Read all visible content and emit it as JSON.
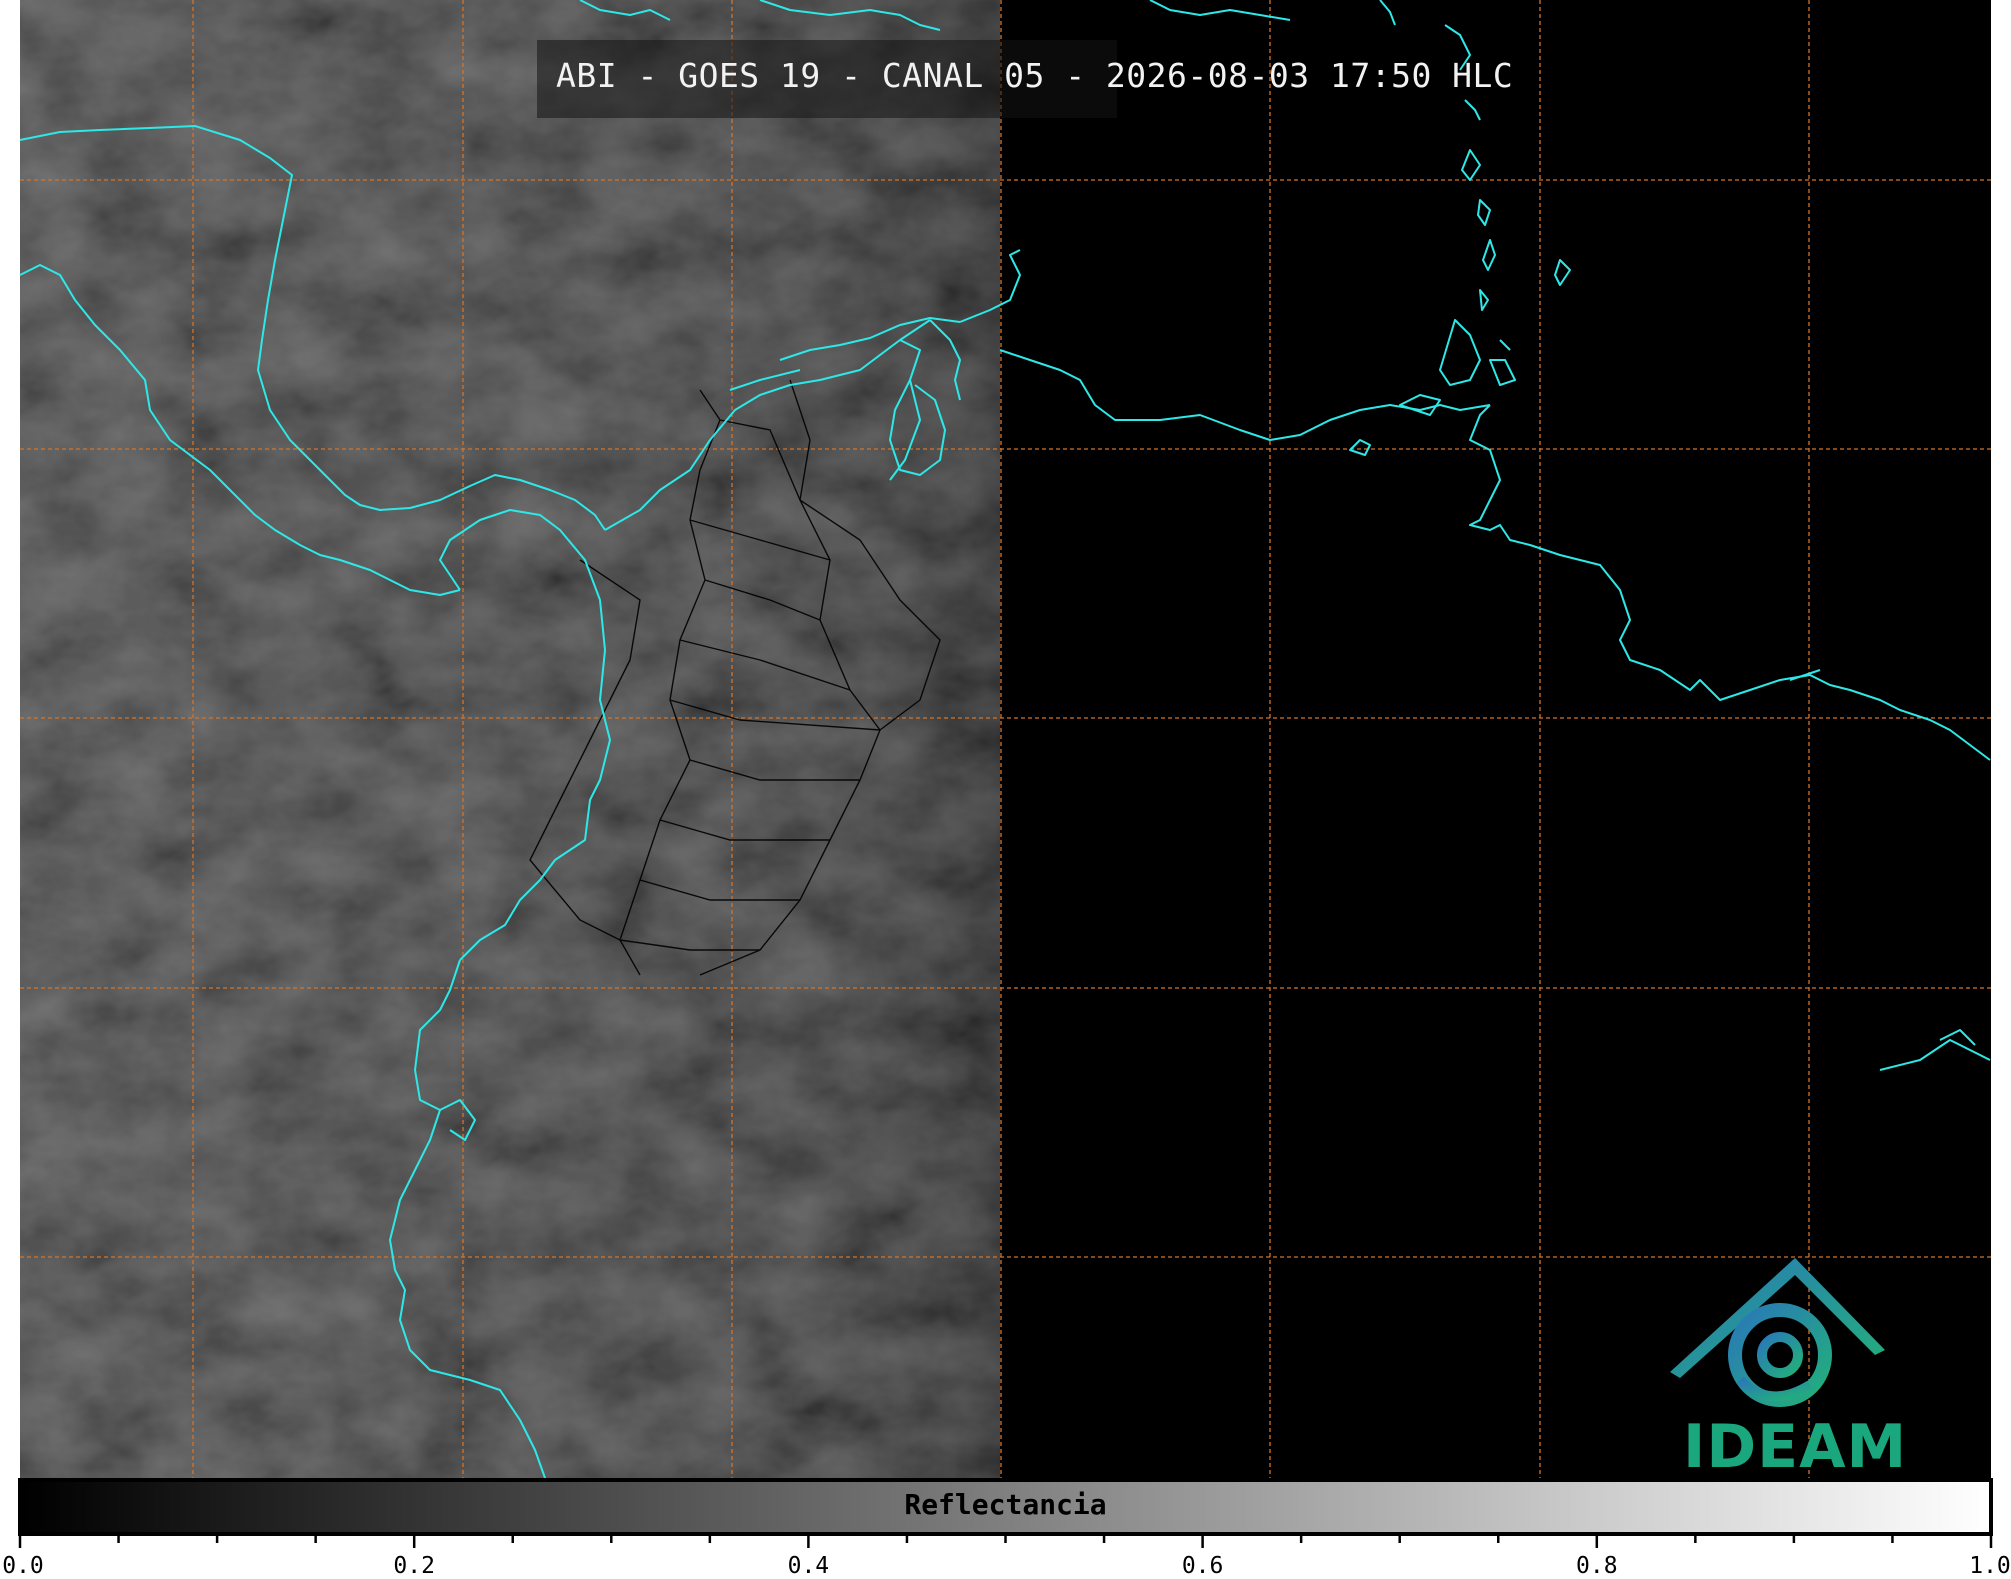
{
  "title": "ABI - GOES 19 - CANAL 05 - 2026-08-03 17:50 HLC",
  "colorbar": {
    "label": "Reflectancia",
    "ticks": [
      "0.0",
      "0.2",
      "0.4",
      "0.6",
      "0.8",
      "1.0"
    ],
    "min": 0.0,
    "max": 1.0,
    "colormap": "grayscale"
  },
  "logo": {
    "text": "IDEAM",
    "color": "#1aa77e"
  },
  "colors": {
    "coastline": "#2ee8e8",
    "gridline": "#d4742a",
    "borders": "#000000",
    "background": "#000000"
  },
  "legend_placement": "bottom",
  "grid": true
}
